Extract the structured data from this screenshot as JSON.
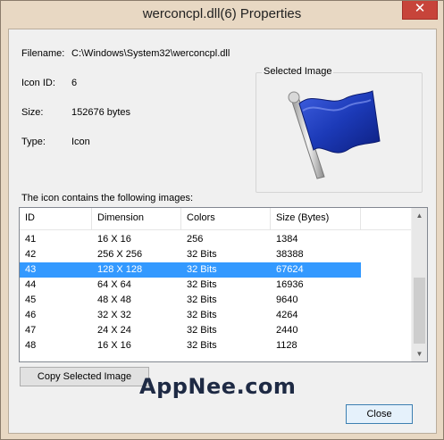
{
  "window": {
    "title": "werconcpl.dll(6) Properties",
    "close_glyph": "✕"
  },
  "info": {
    "filename_label": "Filename:",
    "filename_value": "C:\\Windows\\System32\\werconcpl.dll",
    "iconid_label": "Icon ID:",
    "iconid_value": "6",
    "size_label": "Size:",
    "size_value": "152676 bytes",
    "type_label": "Type:",
    "type_value": "Icon"
  },
  "preview": {
    "legend": "Selected Image",
    "icon": "blue-flag-icon"
  },
  "list": {
    "caption": "The icon contains the following images:",
    "headers": [
      "ID",
      "Dimension",
      "Colors",
      "Size (Bytes)"
    ],
    "rows": [
      [
        "41",
        "16 X 16",
        "256",
        "1384"
      ],
      [
        "42",
        "256 X 256",
        "32 Bits",
        "38388"
      ],
      [
        "43",
        "128 X 128",
        "32 Bits",
        "67624"
      ],
      [
        "44",
        "64 X 64",
        "32 Bits",
        "16936"
      ],
      [
        "45",
        "48 X 48",
        "32 Bits",
        "9640"
      ],
      [
        "46",
        "32 X 32",
        "32 Bits",
        "4264"
      ],
      [
        "47",
        "24 X 24",
        "32 Bits",
        "2440"
      ],
      [
        "48",
        "16 X 16",
        "32 Bits",
        "1128"
      ]
    ],
    "selected_index": 2
  },
  "buttons": {
    "copy": "Copy Selected Image",
    "close": "Close"
  },
  "watermark": "AppNee.com",
  "colors": {
    "selection": "#3399ff",
    "flag": "#1c3ab8"
  }
}
